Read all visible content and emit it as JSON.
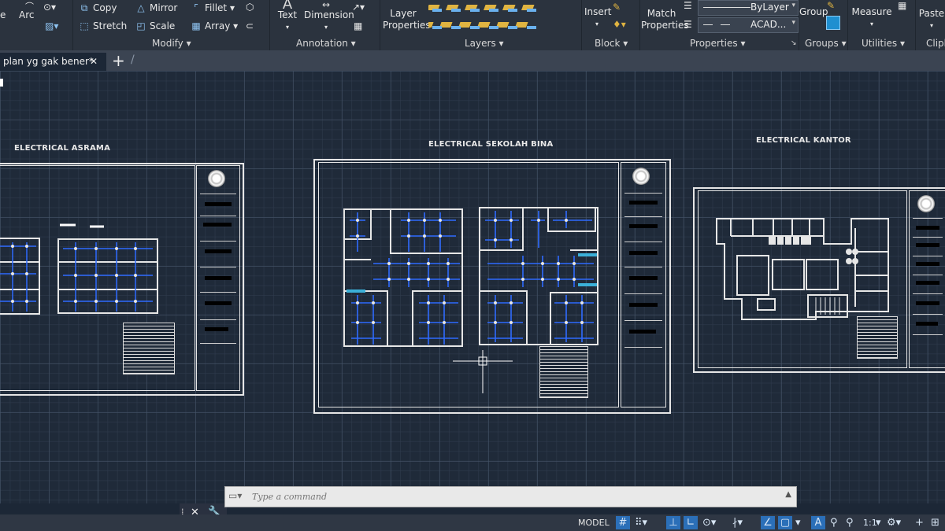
{
  "ribbon": {
    "draw": {
      "arc": "Arc",
      "e": "e"
    },
    "modify": {
      "copy": "Copy",
      "mirror": "Mirror",
      "fillet": "Fillet",
      "stretch": "Stretch",
      "scale": "Scale",
      "array": "Array",
      "panel": "Modify"
    },
    "annotation": {
      "text": "Text",
      "dimension": "Dimension",
      "panel": "Annotation"
    },
    "layers": {
      "layer_properties_1": "Layer",
      "layer_properties_2": "Properties",
      "panel": "Layers"
    },
    "block": {
      "insert": "Insert",
      "panel": "Block"
    },
    "properties": {
      "match_1": "Match",
      "match_2": "Properties",
      "bylayer": "ByLayer",
      "linetype": "ACAD...",
      "panel": "Properties"
    },
    "groups": {
      "group": "Group",
      "panel": "Groups"
    },
    "utilities": {
      "measure": "Measure",
      "panel": "Utilities"
    },
    "clipboard": {
      "paste": "Paste",
      "panel": "Clipb"
    }
  },
  "tabs": {
    "file": "plan yg gak bener*",
    "close": "✕",
    "new": "+"
  },
  "drawings": [
    {
      "title": "ELECTRICAL ASRAMA"
    },
    {
      "title": "ELECTRICAL SEKOLAH BINA"
    },
    {
      "title": "ELECTRICAL KANTOR"
    }
  ],
  "command": {
    "placeholder": "Type a command"
  },
  "status": {
    "model": "MODEL",
    "scale": "1:1"
  },
  "colors": {
    "ribbon": "#2b333e",
    "canvas": "#1f2a39",
    "lines": "#e6e6e6",
    "circuits": "#2f6bff"
  }
}
